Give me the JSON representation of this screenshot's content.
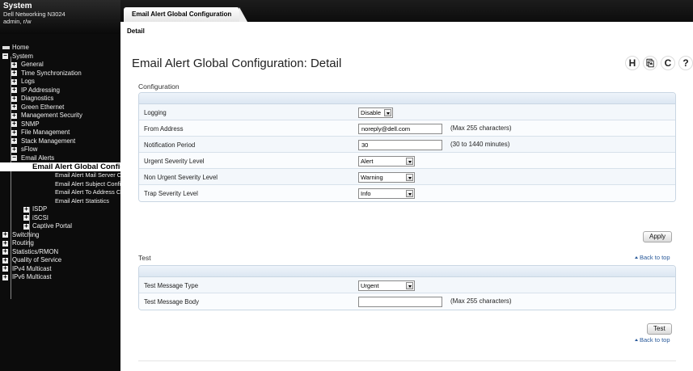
{
  "sidebar": {
    "system_title": "System",
    "device": "Dell Networking N3024",
    "user": "admin, r/w",
    "tree": {
      "home": "Home",
      "system": "System",
      "general": "General",
      "time_sync": "Time Synchronization",
      "logs": "Logs",
      "ip_addressing": "IP Addressing",
      "diagnostics": "Diagnostics",
      "green_ethernet": "Green Ethernet",
      "mgmt_security": "Management Security",
      "snmp": "SNMP",
      "file_mgmt": "File Management",
      "stack_mgmt": "Stack Management",
      "sflow": "sFlow",
      "email_alerts": "Email Alerts",
      "email_alert_global": "Email Alert Global Configuration",
      "email_alert_mail_server": "Email Alert Mail Server Configuration",
      "email_alert_subject": "Email Alert Subject Configuration",
      "email_alert_to_address": "Email Alert To Address Configuration",
      "email_alert_statistics": "Email Alert Statistics",
      "isdp": "ISDP",
      "iscsi": "iSCSI",
      "captive_portal": "Captive Portal",
      "switching": "Switching",
      "routing": "Routing",
      "statistics_rmon": "Statistics/RMON",
      "qos": "Quality of Service",
      "ipv4_multicast": "IPv4 Multicast",
      "ipv6_multicast": "IPv6 Multicast"
    }
  },
  "header": {
    "tab": "Email Alert Global Configuration",
    "subtab": "Detail"
  },
  "main": {
    "title": "Email Alert Global Configuration: Detail",
    "toolbar": {
      "help_h": "H",
      "refresh": "C",
      "question": "?"
    },
    "config": {
      "section_title": "Configuration",
      "rows": {
        "logging": {
          "label": "Logging",
          "value": "Disable"
        },
        "from_address": {
          "label": "From Address",
          "value": "noreply@dell.com",
          "hint": "(Max 255 characters)"
        },
        "notification_period": {
          "label": "Notification Period",
          "value": "30",
          "hint": "(30 to 1440 minutes)"
        },
        "urgent": {
          "label": "Urgent Severity Level",
          "value": "Alert"
        },
        "non_urgent": {
          "label": "Non Urgent Severity Level",
          "value": "Warning"
        },
        "trap": {
          "label": "Trap Severity Level",
          "value": "Info"
        }
      },
      "apply": "Apply"
    },
    "test": {
      "section_title": "Test",
      "back_to_top": "Back to top",
      "rows": {
        "type": {
          "label": "Test Message Type",
          "value": "Urgent"
        },
        "body": {
          "label": "Test Message Body",
          "value": "",
          "hint": "(Max 255 characters)"
        }
      },
      "test_button": "Test",
      "back_to_top_2": "Back to top"
    }
  }
}
